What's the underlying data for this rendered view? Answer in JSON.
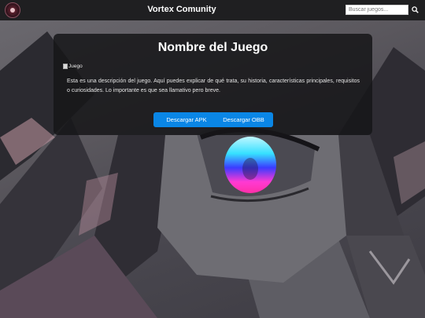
{
  "header": {
    "logo_icon": "avatar-logo-icon",
    "title": "Vortex Comunity",
    "search": {
      "placeholder": "Buscar juegos...",
      "value": ""
    },
    "search_icon": "search-icon"
  },
  "card": {
    "title": "Nombre del Juego",
    "image_alt": "Juego",
    "description": "Esta es una descripción del juego. Aquí puedes explicar de qué trata, su historia, características principales, requisitos o curiosidades. Lo importante es que sea llamativo pero breve.",
    "buttons": {
      "apk_label": "Descargar APK",
      "obb_label": "Descargar OBB"
    }
  },
  "colors": {
    "header_bg": "#1f1f21",
    "card_bg": "rgba(22,22,24,0.86)",
    "button_bg": "#0a86e6",
    "button_text": "#ffffff"
  }
}
